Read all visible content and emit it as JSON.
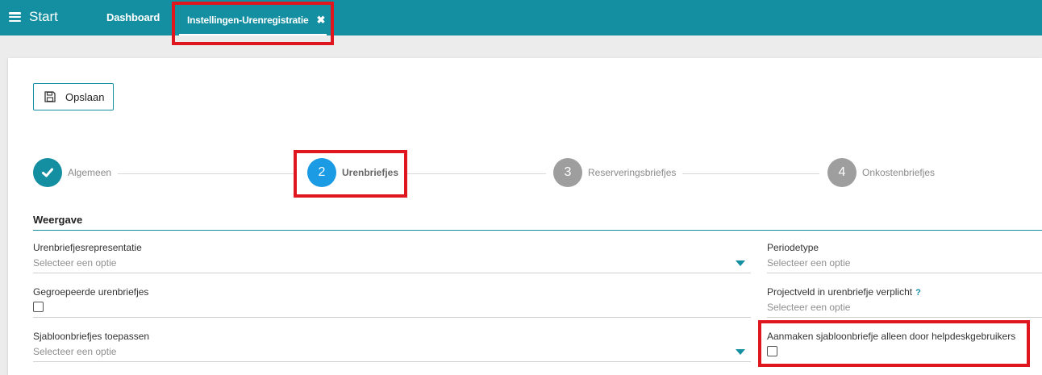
{
  "topbar": {
    "menu_label": "Start",
    "tabs": [
      {
        "label": "Dashboard"
      },
      {
        "label": "Instellingen-Urenregistratie",
        "close": "✖"
      }
    ]
  },
  "toolbar": {
    "save_label": "Opslaan"
  },
  "steps": [
    {
      "number": "✓",
      "label": "Algemeen",
      "state": "completed"
    },
    {
      "number": "2",
      "label": "Urenbriefjes",
      "state": "active"
    },
    {
      "number": "3",
      "label": "Reserveringsbriefjes",
      "state": "pending"
    },
    {
      "number": "4",
      "label": "Onkostenbriefjes",
      "state": "pending"
    }
  ],
  "section": {
    "title": "Weergave"
  },
  "fields": {
    "urenbriefjesrepresentatie": {
      "label": "Urenbriefjesrepresentatie",
      "value": "Selecteer een optie"
    },
    "periodetype": {
      "label": "Periodetype",
      "value": "Selecteer een optie"
    },
    "gegroepeerde": {
      "label": "Gegroepeerde urenbriefjes",
      "checked": false
    },
    "projectveld": {
      "label": "Projectveld in urenbriefje verplicht",
      "help": "?",
      "value": "Selecteer een optie"
    },
    "sjabloon_toepassen": {
      "label": "Sjabloonbriefjes toepassen",
      "value": "Selecteer een optie"
    },
    "aanmaken_sjabloon": {
      "label": "Aanmaken sjabloonbriefje alleen door helpdeskgebruikers",
      "checked": false
    }
  },
  "colors": {
    "accent": "#148ea1",
    "highlight": "#e0161f",
    "step_completed": "#148ea1",
    "step_active": "#1a9be3",
    "step_pending": "#9e9e9e"
  }
}
